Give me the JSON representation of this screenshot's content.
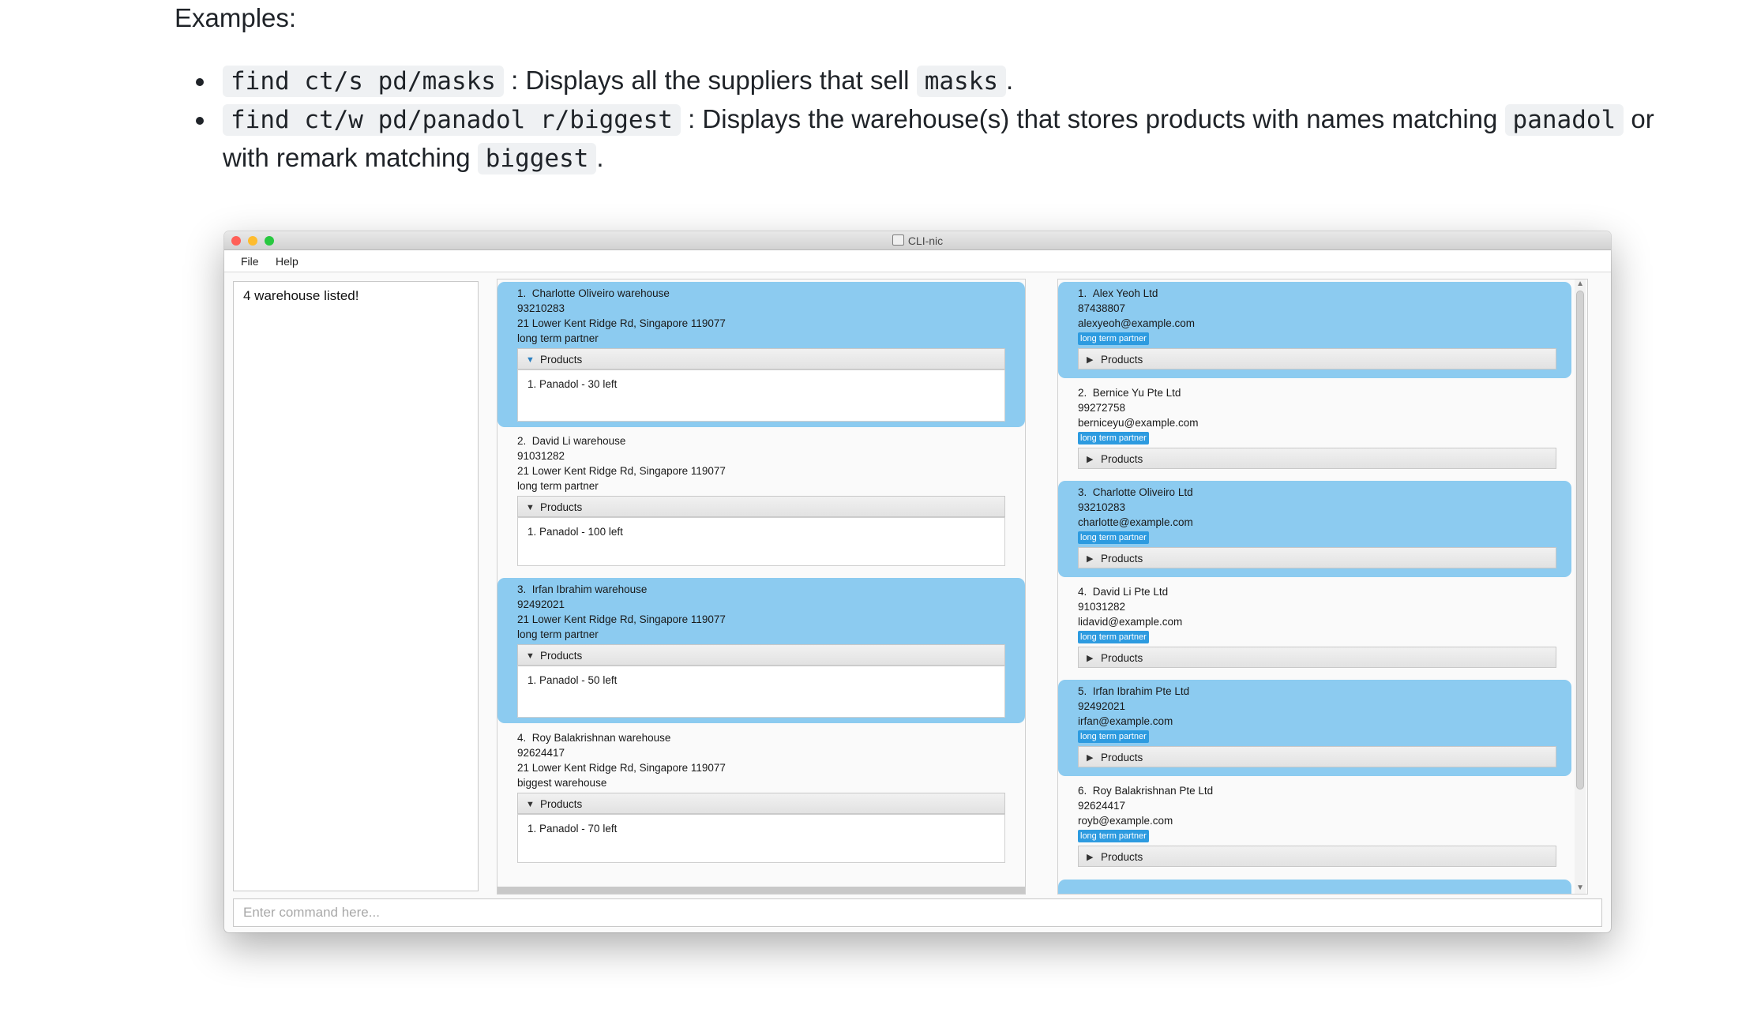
{
  "doc": {
    "heading": "Examples:",
    "examples": [
      {
        "command": "find ct/s pd/masks",
        "text1": " : Displays all the suppliers that sell ",
        "code2": "masks",
        "text2": "."
      },
      {
        "command": "find ct/w pd/panadol r/biggest",
        "text1": " : Displays the warehouse(s) that stores products with names matching ",
        "code2": "panadol",
        "text2": " or with remark matching ",
        "code3": "biggest",
        "text3": "."
      }
    ]
  },
  "window": {
    "title": "CLI-nic",
    "menu": {
      "file": "File",
      "help": "Help"
    },
    "result_text": "4 warehouse listed!",
    "command_placeholder": "Enter command here...",
    "products_label": "Products",
    "warehouses": [
      {
        "index": "1.",
        "name": "Charlotte Oliveiro warehouse",
        "phone": "93210283",
        "address": "21 Lower Kent Ridge Rd, Singapore 119077",
        "remark": "long term partner",
        "product": "1. Panadol - 30 left"
      },
      {
        "index": "2.",
        "name": "David Li warehouse",
        "phone": "91031282",
        "address": "21 Lower Kent Ridge Rd, Singapore 119077",
        "remark": "long term partner",
        "product": "1. Panadol - 100 left"
      },
      {
        "index": "3.",
        "name": "Irfan Ibrahim warehouse",
        "phone": "92492021",
        "address": "21 Lower Kent Ridge Rd, Singapore 119077",
        "remark": "long term partner",
        "product": "1. Panadol - 50 left"
      },
      {
        "index": "4.",
        "name": "Roy Balakrishnan warehouse",
        "phone": "92624417",
        "address": "21 Lower Kent Ridge Rd, Singapore 119077",
        "remark": "biggest warehouse",
        "product": "1. Panadol - 70 left"
      }
    ],
    "suppliers": [
      {
        "index": "1.",
        "name": "Alex Yeoh Ltd",
        "phone": "87438807",
        "email": "alexyeoh@example.com",
        "tag": "long term partner"
      },
      {
        "index": "2.",
        "name": "Bernice Yu Pte Ltd",
        "phone": "99272758",
        "email": "berniceyu@example.com",
        "tag": "long term partner"
      },
      {
        "index": "3.",
        "name": "Charlotte Oliveiro Ltd",
        "phone": "93210283",
        "email": "charlotte@example.com",
        "tag": "long term partner"
      },
      {
        "index": "4.",
        "name": "David Li Pte Ltd",
        "phone": "91031282",
        "email": "lidavid@example.com",
        "tag": "long term partner"
      },
      {
        "index": "5.",
        "name": "Irfan Ibrahim Pte Ltd",
        "phone": "92492021",
        "email": "irfan@example.com",
        "tag": "long term partner"
      },
      {
        "index": "6.",
        "name": "Roy Balakrishnan Pte Ltd",
        "phone": "92624417",
        "email": "royb@example.com",
        "tag": "long term partner"
      }
    ]
  },
  "colors": {
    "selected_card": "#8ccbf0",
    "tag": "#2d9be0"
  }
}
